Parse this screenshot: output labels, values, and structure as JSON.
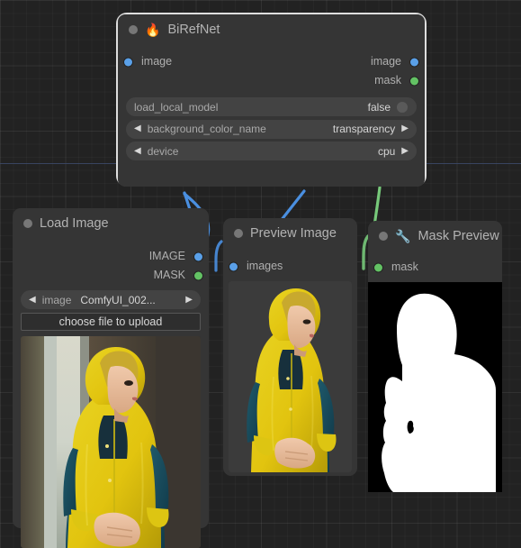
{
  "app": {
    "name": "ComfyUI Node Graph",
    "canvas_bg": "#222222",
    "node_bg": "#353535",
    "widget_bg": "#434343",
    "selected_border": "#dedede",
    "link_blue": "#4a8fe0",
    "link_green": "#77c97a",
    "slot_blue": "#5aa0e8",
    "slot_green": "#63c264",
    "guide_line_color": "#3c4a6b"
  },
  "nodes": [
    {
      "id": "birefnet",
      "title": "BiRefNet",
      "emoji": "🔥",
      "selected": true,
      "inputs": [
        {
          "name": "image",
          "type": "IMAGE",
          "color": "#5aa0e8"
        }
      ],
      "outputs": [
        {
          "name": "image",
          "type": "IMAGE",
          "color": "#5aa0e8"
        },
        {
          "name": "mask",
          "type": "MASK",
          "color": "#63c264"
        }
      ],
      "widgets": [
        {
          "kind": "toggle",
          "name": "load_local_model",
          "value": "false"
        },
        {
          "kind": "combo",
          "name": "background_color_name",
          "value": "transparency",
          "left_arrow": "◀",
          "right_arrow": "▶"
        },
        {
          "kind": "combo",
          "name": "device",
          "value": "cpu",
          "left_arrow": "◀",
          "right_arrow": "▶"
        }
      ]
    },
    {
      "id": "load-image",
      "title": "Load Image",
      "emoji": "",
      "selected": false,
      "inputs": [],
      "outputs": [
        {
          "name": "IMAGE",
          "type": "IMAGE",
          "color": "#5aa0e8"
        },
        {
          "name": "MASK",
          "type": "MASK",
          "color": "#63c264"
        }
      ],
      "widgets": [
        {
          "kind": "combo",
          "name": "image",
          "value": "ComfyUI_002...",
          "left_arrow": "◀",
          "right_arrow": "▶"
        },
        {
          "kind": "button",
          "name": "upload",
          "value": "choose file to upload"
        }
      ],
      "preview_alt": "Woman in yellow hooded jacket beside a window"
    },
    {
      "id": "preview-image",
      "title": "Preview Image",
      "emoji": "",
      "selected": false,
      "inputs": [
        {
          "name": "images",
          "type": "IMAGE",
          "color": "#5aa0e8"
        }
      ],
      "outputs": [],
      "widgets": [],
      "preview_alt": "Woman in yellow hooded jacket, background removed"
    },
    {
      "id": "mask-preview",
      "title": "Mask Preview",
      "emoji": "🔧",
      "selected": false,
      "inputs": [
        {
          "name": "mask",
          "type": "MASK",
          "color": "#63c264"
        }
      ],
      "outputs": [],
      "widgets": [],
      "preview_alt": "White silhouette mask on black background"
    }
  ],
  "links": [
    {
      "from": "load-image.IMAGE",
      "to": "birefnet.image",
      "color": "#4a8fe0"
    },
    {
      "from": "birefnet.image",
      "to": "preview-image.images",
      "color": "#4a8fe0"
    },
    {
      "from": "birefnet.mask",
      "to": "mask-preview.mask",
      "color": "#77c97a"
    }
  ]
}
